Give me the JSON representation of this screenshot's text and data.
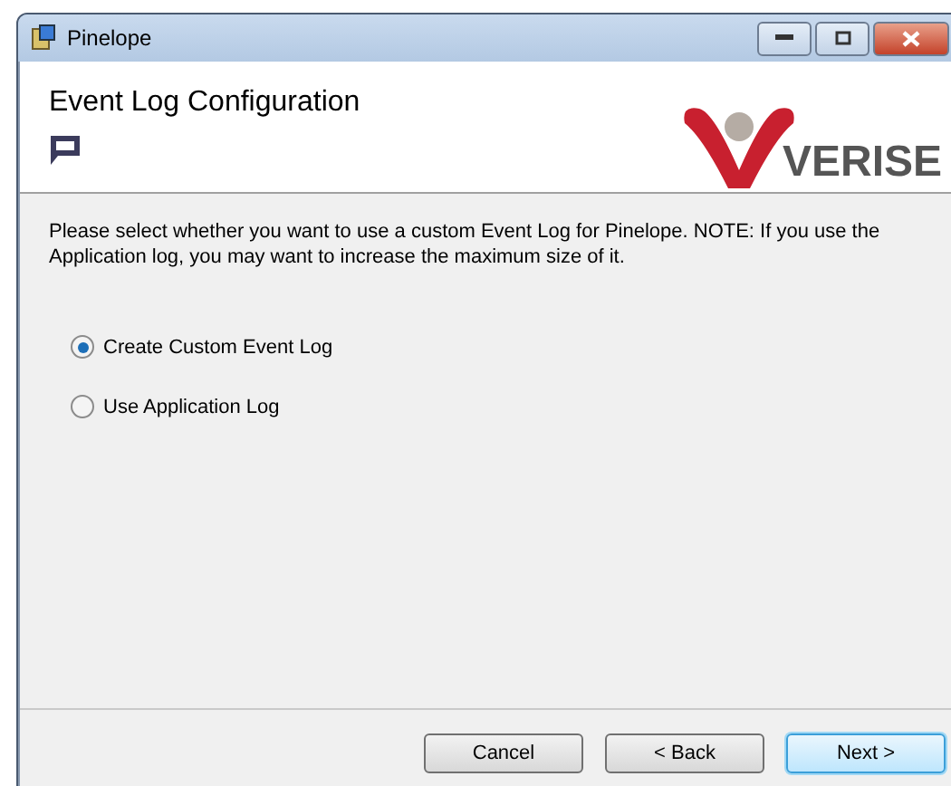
{
  "window": {
    "title": "Pinelope"
  },
  "header": {
    "title": "Event Log Configuration",
    "logo_text": "VERISE"
  },
  "description": "Please select whether you want to use a custom Event Log for Pinelope. NOTE: If you use the Application log, you may want to increase the maximum size of it.",
  "options": [
    {
      "label": "Create Custom Event Log",
      "selected": true
    },
    {
      "label": "Use Application Log",
      "selected": false
    }
  ],
  "buttons": [
    {
      "label": "Cancel",
      "default": false
    },
    {
      "label": "< Back",
      "default": false
    },
    {
      "label": "Next >",
      "default": true
    }
  ]
}
